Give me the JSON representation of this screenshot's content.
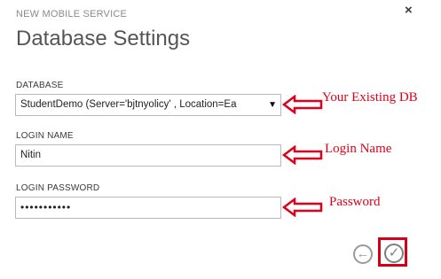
{
  "dialog": {
    "wizard_caption": "NEW MOBILE SERVICE",
    "title": "Database Settings",
    "close_glyph": "×"
  },
  "fields": {
    "database": {
      "label": "DATABASE",
      "selected_value": "StudentDemo (Server='bjtnyolicy' , Location=Ea",
      "caret": "▼"
    },
    "login_name": {
      "label": "LOGIN NAME",
      "value": "Nitin"
    },
    "login_password": {
      "label": "LOGIN PASSWORD",
      "masked_value": "•••••••••••"
    }
  },
  "annotations": {
    "database_note": "Your Existing DB",
    "login_name_note": "Login Name",
    "password_note": "Password",
    "color": "#e0001b"
  },
  "navigation": {
    "back_glyph": "←",
    "complete_glyph": "✓",
    "highlight_color": "#d4001a"
  },
  "icons": [
    "close-icon",
    "chevron-down-icon",
    "arrow-left-icon",
    "checkmark-icon"
  ]
}
